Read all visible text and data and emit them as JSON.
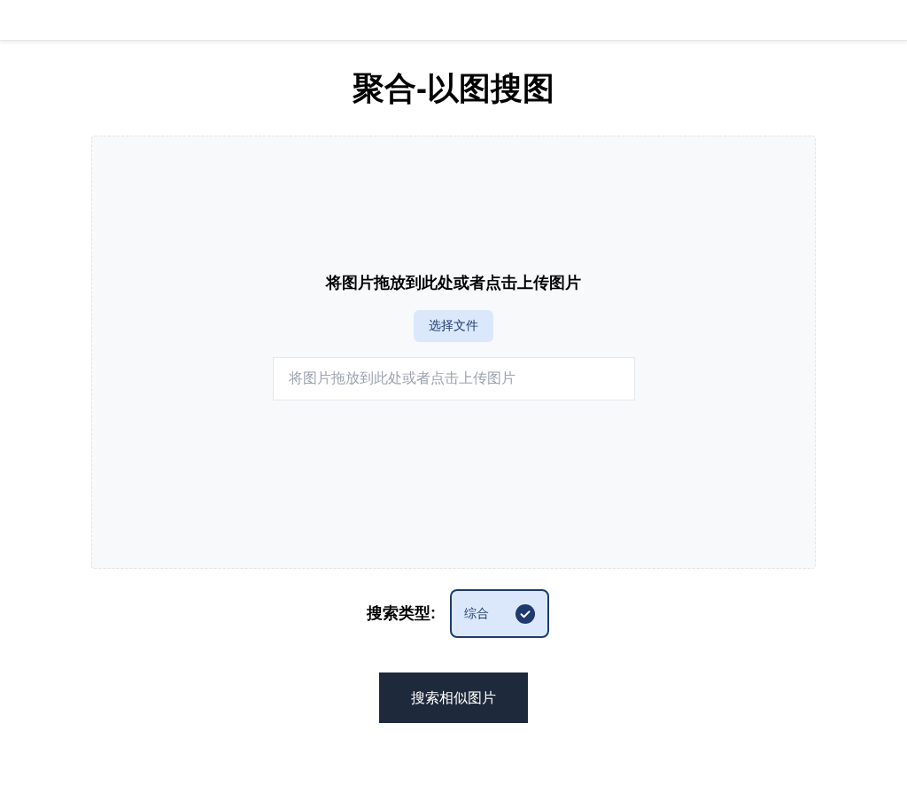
{
  "title": "聚合-以图搜图",
  "upload": {
    "heading": "将图片拖放到此处或者点击上传图片",
    "button": "选择文件",
    "placeholder": "将图片拖放到此处或者点击上传图片"
  },
  "search_type": {
    "label": "搜索类型:",
    "options": [
      {
        "label": "综合",
        "selected": true
      }
    ]
  },
  "submit": "搜索相似图片"
}
